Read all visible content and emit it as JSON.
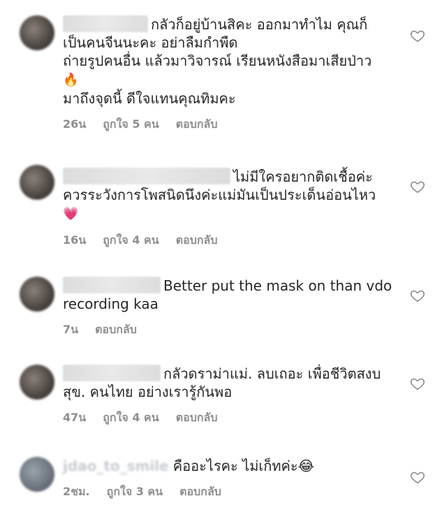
{
  "comments": [
    {
      "username": "",
      "lines": [
        "กลัวก็อยู่บ้านสิคะ ออกมาทำไม คุณก็",
        "เป็นคนจีนนะคะ อย่าลืมกำพืด",
        "ถ่ายรูปคนอื่น แล้วมาวิจารณ์ เรียนหนังสือมาเสียป่าว",
        "🔥",
        "มาถึงจุดนี้ ดีใจแทนคุณทิมคะ"
      ],
      "time": "26น",
      "likes": "ถูกใจ 5 คน",
      "reply": "ตอบกลับ"
    },
    {
      "username": "",
      "lines": [
        "ไม่มีใครอยากติดเชื้อค่ะ",
        "ควรระวังการโพสนิดนึงค่ะแม่มันเป็นประเด็นอ่อนไหว",
        "💗"
      ],
      "time": "16น",
      "likes": "ถูกใจ 4 คน",
      "reply": "ตอบกลับ"
    },
    {
      "username": "",
      "lines": [
        "Better put the mask on than vdo",
        "recording kaa"
      ],
      "time": "7น",
      "likes": "",
      "reply": "ตอบกลับ"
    },
    {
      "username": "",
      "lines": [
        "กลัวดราม่าแม่. ลบเถอะ เพื่อชีวิตสงบ",
        "สุข. คนไทย อย่างเรารู้กันพอ"
      ],
      "time": "47น",
      "likes": "ถูกใจ 4 คน",
      "reply": "ตอบกลับ"
    },
    {
      "username": "jdao_to_smile",
      "lines": [
        "คืออะไรคะ ไม่เก็ทค่ะ😂"
      ],
      "time": "2ชม.",
      "likes": "ถูกใจ 3 คน",
      "reply": "ตอบกลับ"
    }
  ],
  "icons": {
    "like": "heart-outline-icon",
    "avatar": "blurred-avatar"
  },
  "colors": {
    "text": "#262626",
    "meta": "#8e8e8e",
    "icon": "#8e8e8e"
  }
}
